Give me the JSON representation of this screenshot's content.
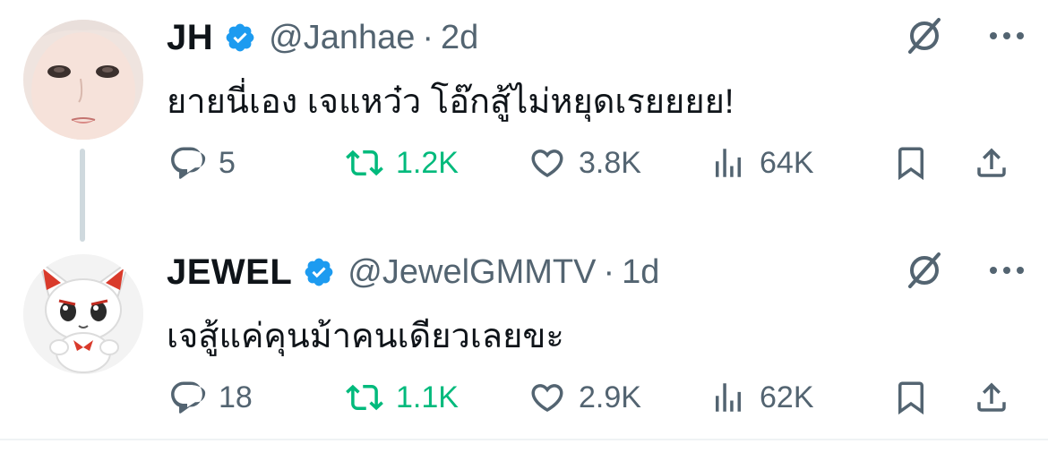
{
  "tweets": [
    {
      "display_name": "JH",
      "handle": "@Janhae",
      "separator": "·",
      "time": "2d",
      "text": "ยายนี่เอง เจแหว๋ว โอ๊กสู้ไม่หยุดเรยยยย!",
      "avatar_icon": "user-photo-avatar",
      "actions": {
        "replies": "5",
        "retweets": "1.2K",
        "likes": "3.8K",
        "views": "64K"
      }
    },
    {
      "display_name": "JEWEL",
      "handle": "@JewelGMMTV",
      "separator": "·",
      "time": "1d",
      "text": "เจสู้แค่คุนม้าคนเดียวเลยขะ",
      "avatar_icon": "plush-toy-avatar",
      "actions": {
        "replies": "18",
        "retweets": "1.1K",
        "likes": "2.9K",
        "views": "62K"
      }
    }
  ],
  "colors": {
    "text_primary": "#0f1419",
    "text_secondary": "#536471",
    "verified_blue": "#1d9bf0",
    "retweet_green": "#00ba7c",
    "thread_line": "#cfd9de"
  }
}
